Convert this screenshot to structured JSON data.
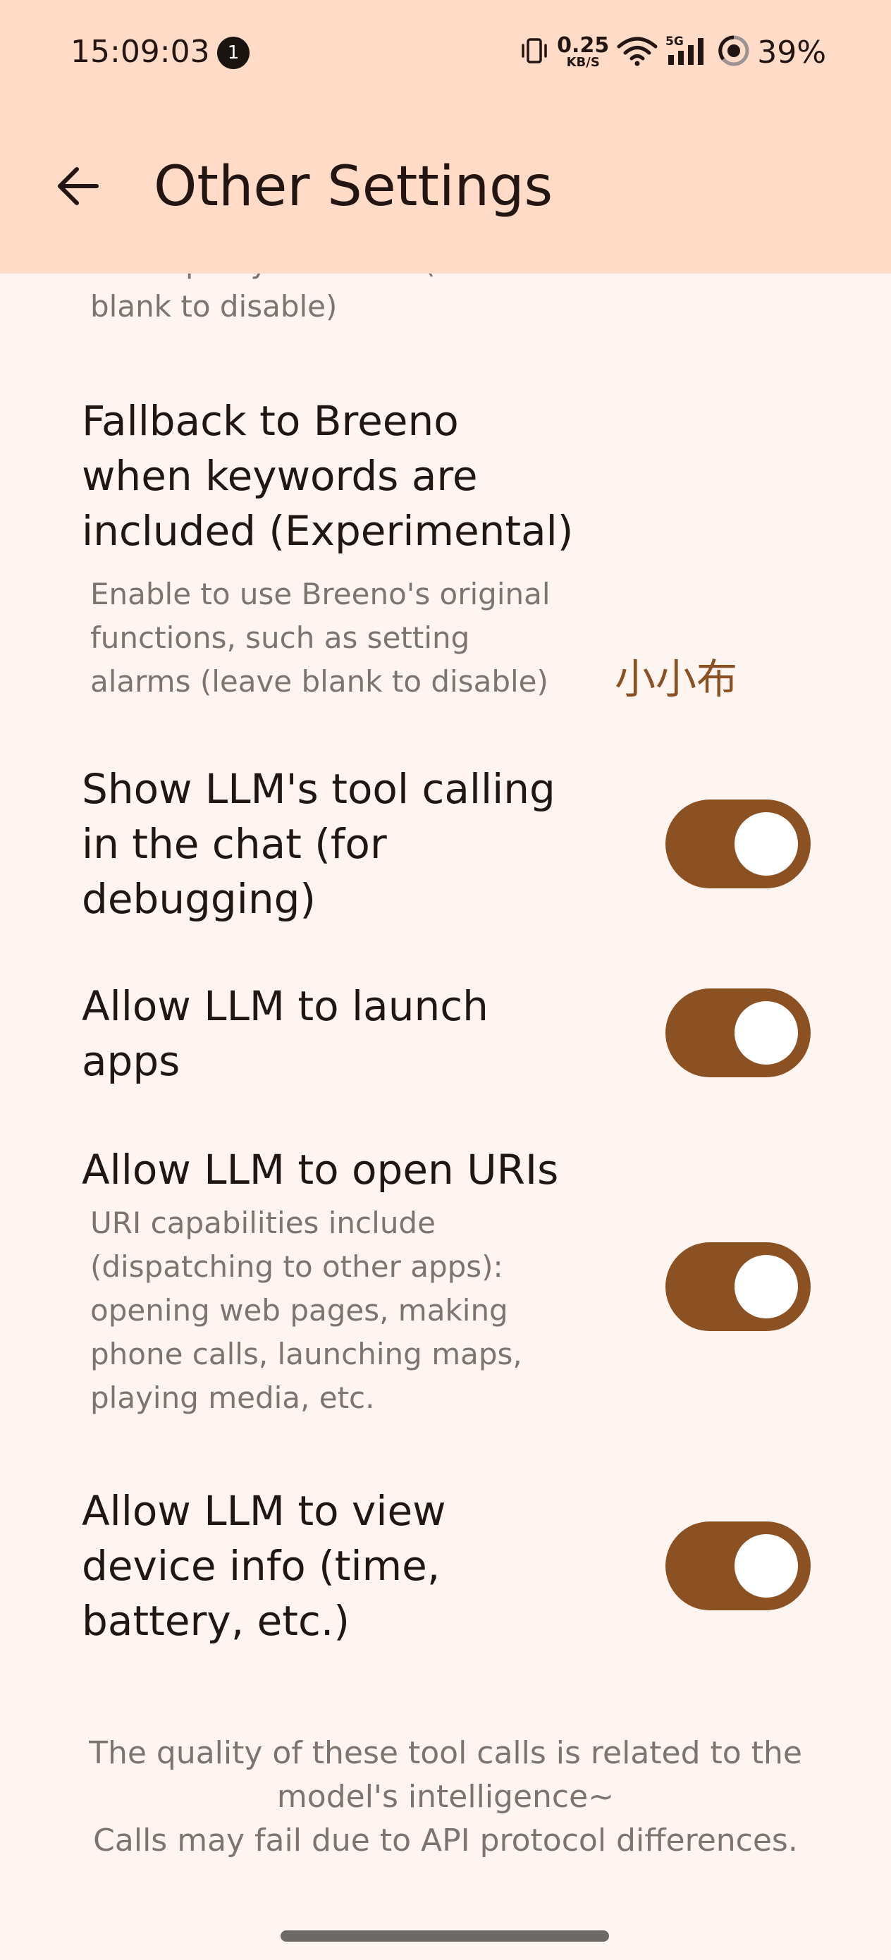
{
  "status_bar": {
    "time": "15:09:03",
    "notification_count": "1",
    "net_speed_value": "0.25",
    "net_speed_unit": "KB/S",
    "network_type": "5G",
    "battery": "39%",
    "icons": [
      "vibrate-icon",
      "wifi-icon",
      "cellular-signal-icon",
      "battery-icon"
    ]
  },
  "app_bar": {
    "title": "Other Settings",
    "back_icon": "arrow-back-icon"
  },
  "settings": {
    "clipped_summary_line1": "Socks proxy for traffic (leave",
    "clipped_summary_line2": "blank to disable)",
    "fallback": {
      "title_line1": "Fallback to Breeno",
      "title_line2": "when keywords are",
      "title_line3": "included (Experimental)",
      "summary_line1": "Enable to use Breeno's original",
      "summary_line2": "functions, such as setting",
      "summary_line3": "alarms (leave blank to disable)",
      "value": "小小布"
    },
    "show_tool_calling": {
      "title_line1": "Show LLM's tool calling",
      "title_line2": "in the chat (for",
      "title_line3": "debugging)",
      "enabled": true
    },
    "launch_apps": {
      "title_line1": "Allow LLM to launch",
      "title_line2": "apps",
      "enabled": true
    },
    "open_uris": {
      "title": "Allow LLM to open URIs",
      "summary_line1": "URI capabilities include",
      "summary_line2": "(dispatching to other apps):",
      "summary_line3": "opening web pages, making",
      "summary_line4": "phone calls, launching maps,",
      "summary_line5": "playing media, etc.",
      "enabled": true
    },
    "view_device_info": {
      "title_line1": "Allow LLM to view",
      "title_line2": "device info (time,",
      "title_line3": "battery, etc.)",
      "enabled": true
    }
  },
  "footer": {
    "line1": "The quality of these tool calls is related to the",
    "line2": "model's intelligence~",
    "line3": "Calls may fail due to API protocol differences."
  },
  "colors": {
    "app_bar_bg": "#FFDBC8",
    "page_bg": "#FFF5F0",
    "accent": "#8C5123",
    "primary_text": "#231512",
    "secondary_text": "#7C7470"
  }
}
